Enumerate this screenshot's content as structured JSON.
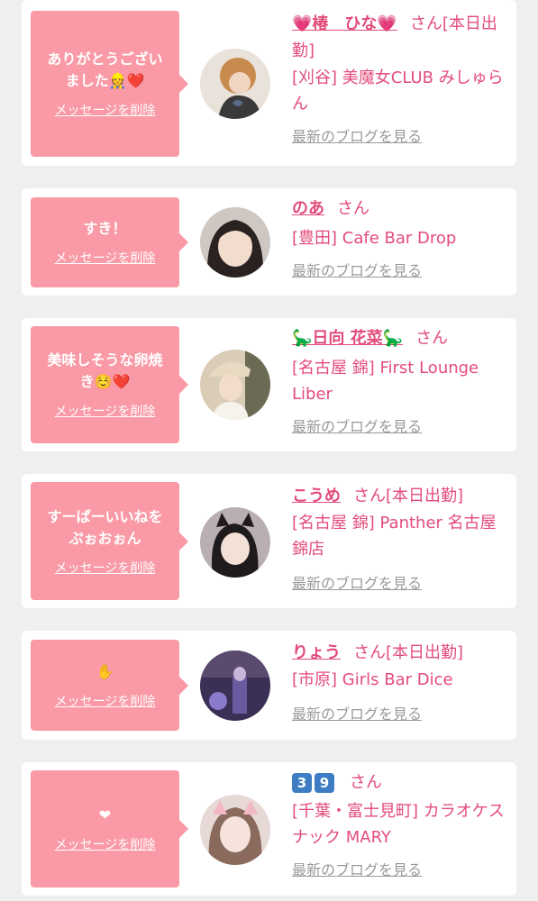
{
  "cards": [
    {
      "message": "ありがとうござい\nました👷❤️",
      "delete_label": "メッセージを削除",
      "name": "💗椿　ひな💗",
      "san": "さん",
      "badge": "[本日出勤]",
      "shop": "[刈谷] 美魔女CLUB みしゅらん",
      "blog_label": "最新のブログを見る"
    },
    {
      "message": "すき！",
      "delete_label": "メッセージを削除",
      "name": "のあ",
      "san": "さん",
      "badge": "",
      "shop": "[豊田] Cafe Bar Drop",
      "blog_label": "最新のブログを見る"
    },
    {
      "message": "美味しそうな卵焼\nき☺️❤️",
      "delete_label": "メッセージを削除",
      "name": "🦕日向 花菜🦕",
      "san": "さん",
      "badge": "",
      "shop": "[名古屋 錦] First Lounge Liber",
      "blog_label": "最新のブログを見る"
    },
    {
      "message": "すーぱーいいねを\nぷぉおぉん",
      "delete_label": "メッセージを削除",
      "name": "こうめ",
      "san": "さん",
      "badge": "[本日出勤]",
      "shop": "[名古屋 錦] Panther 名古屋錦店",
      "blog_label": "最新のブログを見る"
    },
    {
      "message": "✋",
      "delete_label": "メッセージを削除",
      "name": "りょう",
      "san": "さん",
      "badge": "[本日出勤]",
      "shop": "[市原] Girls Bar Dice",
      "blog_label": "最新のブログを見る"
    },
    {
      "message": "❤",
      "delete_label": "メッセージを削除",
      "name_digits": [
        "3",
        "9"
      ],
      "name": "",
      "san": "さん",
      "badge": "",
      "shop": "[千葉・富士見町] カラオケスナック MARY",
      "blog_label": "最新のブログを見る"
    }
  ],
  "colors": {
    "bubble": "#f99aa6",
    "name": "#e34c7b",
    "blog_link": "#9a9a9a",
    "background": "#f0eff0"
  }
}
